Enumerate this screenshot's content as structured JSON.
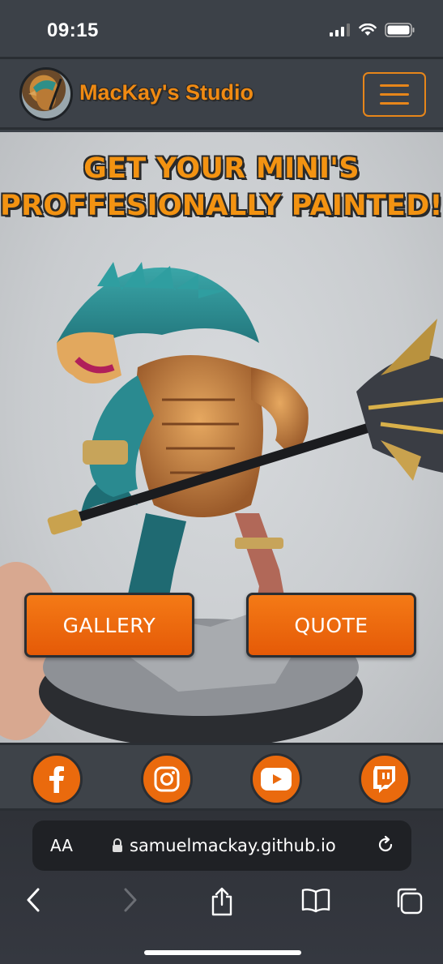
{
  "status": {
    "time": "09:15"
  },
  "navbar": {
    "brand": "MacKay's Studio"
  },
  "hero": {
    "title_line1": "GET YOUR MINI'S",
    "title_line2": "PROFFESIONALLY PAINTED!",
    "buttons": {
      "gallery": "GALLERY",
      "quote": "QUOTE"
    }
  },
  "social": [
    "facebook-icon",
    "instagram-icon",
    "youtube-icon",
    "twitch-icon"
  ],
  "browser": {
    "text_size": "AA",
    "url": "samuelmackay.github.io"
  },
  "colors": {
    "accent": "#f08a12",
    "button": "#e55a07",
    "dark": "#3c4148"
  }
}
